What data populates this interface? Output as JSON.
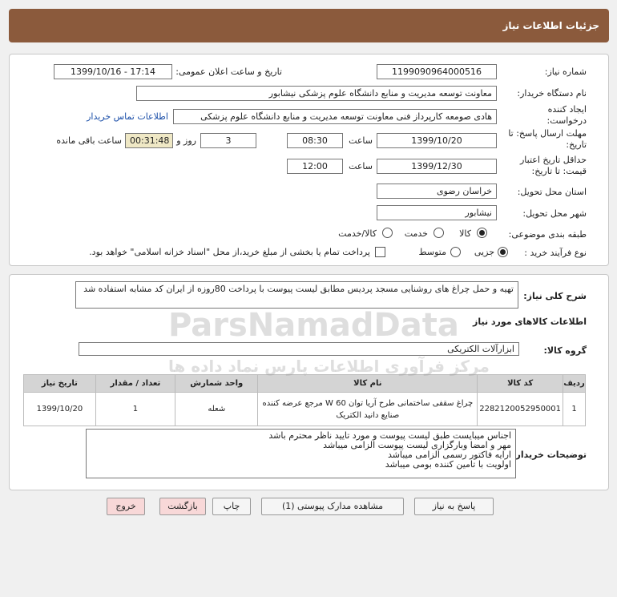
{
  "header": {
    "title": "جزئیات اطلاعات نیاز"
  },
  "form": {
    "need_number_label": "شماره نیاز:",
    "need_number": "1199090964000516",
    "announce_label": "تاریخ و ساعت اعلان عمومی:",
    "announce_value": "1399/10/16 - 17:14",
    "buyer_label": "نام دستگاه خریدار:",
    "buyer_value": "معاونت توسعه مدیریت و منابع دانشگاه علوم پزشکی نیشابور",
    "creator_label": "ایجاد کننده درخواست:",
    "creator_value": "هادی صومعه کارپرداز فنی معاونت توسعه مدیریت و منابع دانشگاه علوم پزشکی",
    "contact_link": "اطلاعات تماس خریدار",
    "deadline_label": "مهلت ارسال پاسخ: تا تاریخ:",
    "deadline_date": "1399/10/20",
    "time_label": "ساعت",
    "deadline_time": "08:30",
    "days_value": "3",
    "days_label": "روز و",
    "remaining_value": "00:31:48",
    "remaining_label": "ساعت باقی مانده",
    "validity_label": "حداقل تاریخ اعتبار قیمت: تا تاریخ:",
    "validity_date": "1399/12/30",
    "validity_time": "12:00",
    "province_label": "استان محل تحویل:",
    "province_value": "خراسان رضوی",
    "city_label": "شهر محل تحویل:",
    "city_value": "نیشابور",
    "category_label": "طبقه بندی موضوعی:",
    "category_options": [
      "کالا",
      "خدمت",
      "کالا/خدمت"
    ],
    "process_label": "نوع فرآیند خرید :",
    "process_options": [
      "جزیی",
      "متوسط"
    ],
    "payment_note": "پرداخت تمام یا بخشی از مبلغ خرید،از محل \"اسناد خزانه اسلامی\" خواهد بود."
  },
  "details": {
    "description_label": "شرح کلی نیاز:",
    "description_value": "تهیه و حمل چراغ های روشنایی مسجد پردیس مطابق لیست پیوست با پرداخت 80روزه از ایران کد مشابه استفاده شد",
    "goods_info_title": "اطلاعات کالاهای مورد نیاز",
    "group_label": "گروه کالا:",
    "group_value": "ابزارآلات الکتریکی"
  },
  "table": {
    "headers": [
      "ردیف",
      "کد کالا",
      "نام کالا",
      "واحد شمارش",
      "تعداد / مقدار",
      "تاریخ نیاز"
    ],
    "rows": [
      [
        "1",
        "2282120052950001",
        "چراغ سقفی ساختمانی طرح آریا توان W 60 مرجع عرضه کننده صنایع دانید الکتریک",
        "شعله",
        "1",
        "1399/10/20"
      ]
    ]
  },
  "notes": {
    "label": "توضیحات خریدار:",
    "lines": [
      "اجناس میبایست طبق لیست پیوست و مورد تایید ناظر محترم باشد",
      "مهر و امضا وبارگزاری لیست پیوست الزامی میباشد",
      "ارایه فاکتور رسمی الزامی میباشد",
      "اولویت با تامین کننده بومی میباشد"
    ]
  },
  "buttons": {
    "reply": "پاسخ به نیاز",
    "attachments": "مشاهده مدارک پیوستی (1)",
    "print": "چاپ",
    "back": "بازگشت",
    "exit": "خروج"
  },
  "watermark": {
    "brand": "ParsNamadData",
    "subtitle": "مرکز فرآوری اطلاعات پارس نماد داده ها"
  }
}
